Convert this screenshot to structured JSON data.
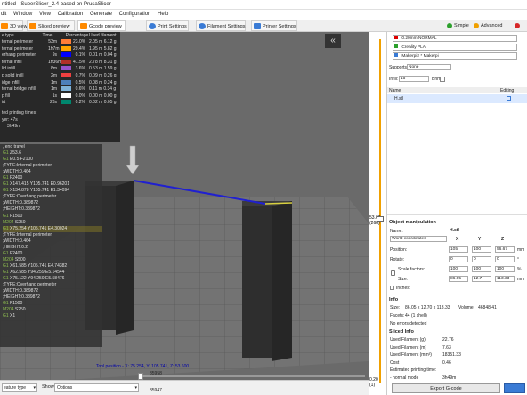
{
  "window": {
    "title": "ntitled - SuperSlicer_2.4  based on PrusaSlicer"
  },
  "menu": [
    "dit",
    "Window",
    "View",
    "Calibration",
    "Generate",
    "Configuration",
    "Help"
  ],
  "tabs": [
    {
      "label": "3D view",
      "icon": "cube-icon",
      "color": "#ff8a00"
    },
    {
      "label": "Sliced preview",
      "icon": "layers-icon",
      "color": "#ff8a00"
    },
    {
      "label": "Gcode preview",
      "icon": "gcode-icon",
      "color": "#ff8a00"
    },
    {
      "label": "Print Settings",
      "icon": "gear-icon",
      "color": "#3a7bd5"
    },
    {
      "label": "Filament Settings",
      "icon": "spool-icon",
      "color": "#3a7bd5"
    },
    {
      "label": "Printer Settings",
      "icon": "printer-icon",
      "color": "#3a7bd5"
    }
  ],
  "modes": [
    {
      "label": "Simple",
      "color": "#2ca02c"
    },
    {
      "label": "Advanced",
      "color": "#f0a000"
    },
    {
      "label": "Expert",
      "color": "#d62728"
    }
  ],
  "legend": {
    "headers": [
      "e type",
      "Time",
      "Percentage",
      "Used filament"
    ],
    "rows": [
      {
        "type": "ternal perimeter",
        "time": "53m",
        "pct": "23.0%",
        "fil": "2.05 m",
        "wt": "6.12 g",
        "color": "#ff7d38"
      },
      {
        "type": "ternal perimeter",
        "time": "1h7m",
        "pct": "29.4%",
        "fil": "1.95 m",
        "wt": "5.82 g",
        "color": "#ffa500"
      },
      {
        "type": "erhang perimeter",
        "time": "9s",
        "pct": "0.1%",
        "fil": "0.01 m",
        "wt": "0.04 g",
        "color": "#0000ff"
      },
      {
        "type": "ternal infill",
        "time": "1h36m",
        "pct": "41.5%",
        "fil": "2.78 m",
        "wt": "8.31 g",
        "color": "#b03029"
      },
      {
        "type": "lid infill",
        "time": "8m",
        "pct": "3.6%",
        "fil": "0.53 m",
        "wt": "1.59 g",
        "color": "#9654cc"
      },
      {
        "type": "p solid infill",
        "time": "2m",
        "pct": "0.7%",
        "fil": "0.09 m",
        "wt": "0.26 g",
        "color": "#f04040"
      },
      {
        "type": "idge infill",
        "time": "1m",
        "pct": "0.5%",
        "fil": "0.08 m",
        "wt": "0.24 g",
        "color": "#4d80ba"
      },
      {
        "type": "ternal bridge infill",
        "time": "1m",
        "pct": "0.6%",
        "fil": "0.11 m",
        "wt": "0.34 g",
        "color": "#80b3d8"
      },
      {
        "type": "p fill",
        "time": "1s",
        "pct": "0.0%",
        "fil": "0.00 m",
        "wt": "0.00 g",
        "color": "#ffffff"
      },
      {
        "type": "irt",
        "time": "23s",
        "pct": "0.2%",
        "fil": "0.02 m",
        "wt": "0.05 g",
        "color": "#00876e"
      }
    ],
    "est_label": "ted printing times:",
    "layer": "yer:  47s",
    "total": "3h49m"
  },
  "gcode": [
    {
      "t": ", end travel",
      "k": false
    },
    {
      "t": "G1 Z53.6",
      "k": true
    },
    {
      "t": "G1 E0.5 F2100",
      "k": true
    },
    {
      "t": ";TYPE:Internal perimeter",
      "k": false
    },
    {
      "t": ";WIDTH:0.464",
      "k": false
    },
    {
      "t": "G1 F2400",
      "k": true
    },
    {
      "t": "G1 X147.415 Y105.741 E0.96201",
      "k": true
    },
    {
      "t": "G1 X134.878 Y105.741 E1.34094",
      "k": true
    },
    {
      "t": ";TYPE:Overhang perimeter",
      "k": false
    },
    {
      "t": ";WIDTH:0.389872",
      "k": false
    },
    {
      "t": ";HEIGHT:0.389872",
      "k": false
    },
    {
      "t": "G1 F1500",
      "k": true
    },
    {
      "t": "M204 S250",
      "k": true
    },
    {
      "t": "G1 X75.254 Y105.741 E4.30024",
      "k": true,
      "h": true
    },
    {
      "t": ";TYPE:Internal perimeter",
      "k": false
    },
    {
      "t": ";WIDTH:0.464",
      "k": false
    },
    {
      "t": ";HEIGHT:0.2",
      "k": false
    },
    {
      "t": "G1 F2400",
      "k": true
    },
    {
      "t": "M204 S500",
      "k": true
    },
    {
      "t": "G1 X61.585 Y105.741 E4.74382",
      "k": true
    },
    {
      "t": "G1 X62.585 Y94.259 E5.14544",
      "k": true
    },
    {
      "t": "G1 X75.122 Y94.259 E5.58476",
      "k": true
    },
    {
      "t": ";TYPE:Overhang perimeter",
      "k": false
    },
    {
      "t": ";WIDTH:0.389872",
      "k": false
    },
    {
      "t": ";HEIGHT:0.389872",
      "k": false
    },
    {
      "t": "G1 F1500",
      "k": true
    },
    {
      "t": "M204 S250",
      "k": true
    },
    {
      "t": "G1 X1",
      "k": true
    }
  ],
  "toolposition": "Tool position - X: 75.254, Y: 105.741, Z: 53.600",
  "hslider": {
    "top": "85958",
    "bottom": "85947"
  },
  "vslider": {
    "top_value": "53.60",
    "top_sub": "(268)",
    "bottom_value": "0.20",
    "bottom_sub": "(1)"
  },
  "bottombar": {
    "feature_label": "eature type",
    "show_label": "Show",
    "show_value": "Options"
  },
  "presets": {
    "print": "0.20mm NORMAL",
    "filament": "Creality PLA",
    "printer": "Makerpi2 * Makerpi"
  },
  "supports": {
    "label": "Supports:",
    "value": "None"
  },
  "infill": {
    "label": "Infill:",
    "value": "15",
    "brim_label": "Brim:"
  },
  "objects": {
    "name_header": "Name",
    "editing_header": "Editing",
    "row": "H.stl"
  },
  "manip": {
    "title": "Object manipulation",
    "name_label": "Name:",
    "name_value": "H.stl",
    "coords": "World coordinates",
    "axes": [
      "X",
      "Y",
      "Z"
    ],
    "position_label": "Position:",
    "position": [
      "105",
      "100",
      "56.67"
    ],
    "position_unit": "mm",
    "rotate_label": "Rotate:",
    "rotate": [
      "0",
      "0",
      "0"
    ],
    "rotate_unit": "°",
    "scale_label": "Scale factors:",
    "scale": [
      "100",
      "100",
      "100"
    ],
    "scale_unit": "%",
    "size_label": "Size:",
    "size": [
      "86.05",
      "12.7",
      "113.33"
    ],
    "size_unit": "mm",
    "inches_label": "Inches:"
  },
  "info": {
    "title": "Info",
    "size_label": "Size:",
    "size_value": "86.05 x 12.70 x 113.33",
    "volume_label": "Volume:",
    "volume_value": "46848.41",
    "facets_label": "Facets:",
    "facets_value": "44 (1 shell)",
    "errors": "No errors detected"
  },
  "sliced": {
    "title": "Sliced Info",
    "rows": [
      {
        "label": "Used Filament (g)",
        "value": "22.76"
      },
      {
        "label": "Used Filament (m)",
        "value": "7.63"
      },
      {
        "label": "Used Filament (mm³)",
        "value": "18351.33"
      },
      {
        "label": "Cost",
        "value": "0.46"
      },
      {
        "label": "Estimated printing time:",
        "value": ""
      },
      {
        "label": " - normal mode",
        "value": "3h49m"
      }
    ]
  },
  "export_label": "Export G-code"
}
